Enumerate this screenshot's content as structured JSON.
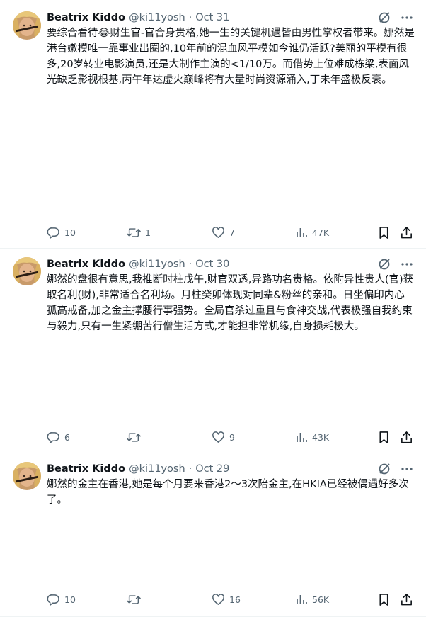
{
  "tweets": [
    {
      "author": "Beatrix Kiddo",
      "handle": "@ki11yosh",
      "separator": "·",
      "date": "Oct 31",
      "text": "要综合看待😂财生官-官合身贵格,她一生的关键机遇皆由男性掌权者带来。娜然是港台嫩模唯一靠事业出圈的,10年前的混血风平模如今谁仍活跃?美丽的平模有很多,20岁转业电影演员,还是大制作主演的<1/10万。而借势上位难成栋梁,表面风光缺乏影视根基,丙午年达虚火巅峰将有大量时尚资源涌入,丁未年盛极反衰。",
      "replies": "10",
      "reposts": "1",
      "likes": "7",
      "views": "47K"
    },
    {
      "author": "Beatrix Kiddo",
      "handle": "@ki11yosh",
      "separator": "·",
      "date": "Oct 30",
      "text": "娜然的盘很有意思,我推断时柱戊午,财官双透,异路功名贵格。依附异性贵人(官)获取名利(财),非常适合名利场。月柱癸卯体现对同辈&粉丝的亲和。日坐偏印内心孤高戒备,加之金主撑腰行事强势。全局官杀过重且与食神交战,代表极强自我约束与毅力,只有一生紧绷苦行僧生活方式,才能担非常机缘,自身损耗极大。",
      "replies": "6",
      "reposts": "",
      "likes": "9",
      "views": "43K"
    },
    {
      "author": "Beatrix Kiddo",
      "handle": "@ki11yosh",
      "separator": "·",
      "date": "Oct 29",
      "text": "娜然的金主在香港,她是每个月要来香港2～3次陪金主,在HKIA已经被偶遇好多次了。",
      "replies": "10",
      "reposts": "",
      "likes": "16",
      "views": "56K"
    }
  ],
  "icons": {
    "grok": "grok-slash-icon",
    "more": "more-dots-icon",
    "reply": "reply-icon",
    "repost": "repost-icon",
    "like": "heart-icon",
    "views": "views-bar-icon",
    "bookmark": "bookmark-icon",
    "share": "share-icon"
  },
  "colors": {
    "text": "#0f1419",
    "muted": "#536471",
    "divider": "#eff3f4"
  }
}
